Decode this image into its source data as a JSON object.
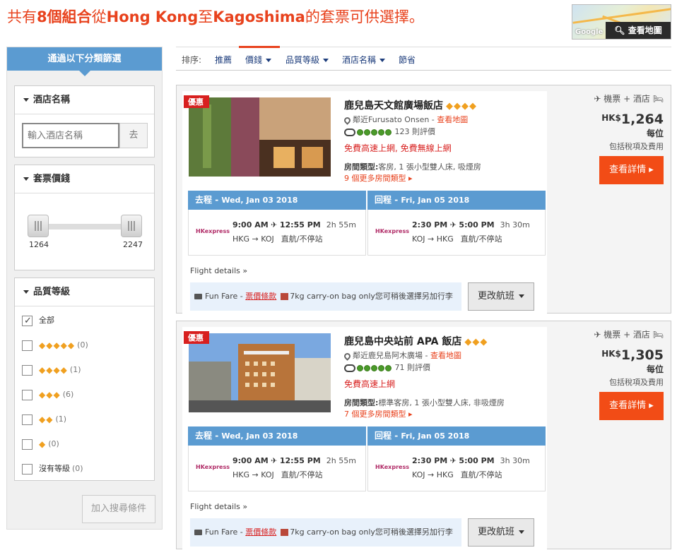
{
  "header": {
    "title_pre": "共有",
    "title_count": "8個組合",
    "title_mid1": "從",
    "title_from": "Hong Kong",
    "title_mid2": "至",
    "title_to": "Kagoshima",
    "title_post": "的套票可供選擇。",
    "map_button": "查看地圖",
    "map_brand": "Google"
  },
  "sidebar": {
    "heading": "通過以下分類篩選",
    "hotel_name": {
      "title": "酒店名稱",
      "placeholder": "輸入酒店名稱",
      "go": "去"
    },
    "price": {
      "title": "套票價錢",
      "min": "1264",
      "max": "2247",
      "range_fraction": [
        0,
        1
      ]
    },
    "rating": {
      "title": "品質等級",
      "options": [
        {
          "label": "全部",
          "checked": true
        },
        {
          "diamonds": "◆◆◆◆◆",
          "count": "(0)",
          "checked": false
        },
        {
          "diamonds": "◆◆◆◆",
          "count": "(1)",
          "checked": false
        },
        {
          "diamonds": "◆◆◆",
          "count": "(6)",
          "checked": false
        },
        {
          "diamonds": "◆◆",
          "count": "(1)",
          "checked": false
        },
        {
          "diamonds": "◆",
          "count": "(0)",
          "checked": false
        },
        {
          "label": "沒有等級",
          "count": "(0)",
          "checked": false
        }
      ]
    },
    "add_button": "加入搜尋條件"
  },
  "sortbar": {
    "label": "排序:",
    "items": [
      "推薦",
      "價錢",
      "品質等級",
      "酒店名稱",
      "節省"
    ],
    "active": "價錢"
  },
  "cards": [
    {
      "badge": "優惠",
      "name": "鹿兒島天文館廣場飯店",
      "diamonds": "◆◆◆◆",
      "location_prefix": "鄰近",
      "location": "Furusato Onsen",
      "map_link": "查看地圖",
      "reviews": "123 則評價",
      "perks": "免費高速上網, 免費無線上網",
      "room_label": "房間類型:",
      "room": "客房, 1 張小型雙人床, 吸煙房",
      "more_rooms": "9 個更多房間類型",
      "outbound": {
        "label": "去程",
        "date": "Wed, Jan 03 2018",
        "depart": "9:00 AM",
        "arrive": "12:55 PM",
        "duration": "2h 55m",
        "route": "HKG → KOJ",
        "stops": "直航/不停站"
      },
      "inbound": {
        "label": "回程",
        "date": "Fri, Jan 05 2018",
        "depart": "2:30 PM",
        "arrive": "5:00 PM",
        "duration": "3h 30m",
        "route": "KOJ → HKG",
        "stops": "直航/不停站"
      },
      "airline": "HKexpress",
      "flight_details": "Flight details",
      "fare_name": "Fun Fare",
      "fare_rules": "票價條款",
      "baggage": "7kg carry-on bag only",
      "baggage_note": "您可稍後選擇另加行李",
      "change_flight": "更改航班",
      "package_label": "機票 + 酒店",
      "currency": "HK$",
      "price": "1,264",
      "per": "每位",
      "incl": "包括稅項及費用",
      "details_button": "查看詳情"
    },
    {
      "badge": "優惠",
      "name": "鹿兒島中央站前 APA 飯店",
      "diamonds": "◆◆◆",
      "location_prefix": "鄰近",
      "location": "鹿兒島阿木廣場",
      "map_link": "查看地圖",
      "reviews": "71 則評價",
      "perks": "免費高速上網",
      "room_label": "房間類型:",
      "room": "標準客房, 1 張小型雙人床, 非吸煙房",
      "more_rooms": "7 個更多房間類型",
      "outbound": {
        "label": "去程",
        "date": "Wed, Jan 03 2018",
        "depart": "9:00 AM",
        "arrive": "12:55 PM",
        "duration": "2h 55m",
        "route": "HKG → KOJ",
        "stops": "直航/不停站"
      },
      "inbound": {
        "label": "回程",
        "date": "Fri, Jan 05 2018",
        "depart": "2:30 PM",
        "arrive": "5:00 PM",
        "duration": "3h 30m",
        "route": "KOJ → HKG",
        "stops": "直航/不停站"
      },
      "airline": "HKexpress",
      "flight_details": "Flight details",
      "fare_name": "Fun Fare",
      "fare_rules": "票價條款",
      "baggage": "7kg carry-on bag only",
      "baggage_note": "您可稍後選擇另加行李",
      "change_flight": "更改航班",
      "package_label": "機票 + 酒店",
      "currency": "HK$",
      "price": "1,305",
      "per": "每位",
      "incl": "包括稅項及費用",
      "details_button": "查看詳情"
    }
  ],
  "colors": {
    "accent": "#e8421d",
    "blue": "#5b9bd1",
    "cta": "#f24c16"
  }
}
